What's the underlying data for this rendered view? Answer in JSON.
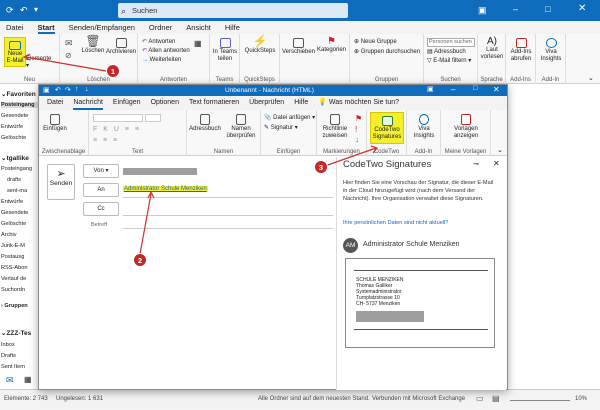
{
  "main": {
    "search_label": "Suchen",
    "tabs": [
      "Datei",
      "Start",
      "Senden/Empfangen",
      "Ordner",
      "Ansicht",
      "Hilfe"
    ],
    "ribbon": {
      "new_email": "Neue E-Mail",
      "new_items": "Elemente",
      "group_new": "Neu",
      "delete": "Löschen",
      "archive": "Archivieren",
      "group_delete": "Löschen",
      "reply": "Antworten",
      "reply_all": "Allen antworten",
      "forward": "Weiterleiten",
      "group_respond": "Antworten",
      "teams_share": "In Teams teilen",
      "group_teams": "Teams",
      "quicksteps": "QuickSteps",
      "group_quicksteps": "QuickSteps",
      "move": "Verschieben",
      "categories": "Kategorien",
      "new_group": "Neue Gruppe",
      "browse_groups": "Gruppen durchsuchen",
      "group_groups": "Gruppen",
      "search_people": "Personen suchen",
      "address_book": "Adressbuch",
      "filter_email": "E-Mail filtern",
      "group_find": "Suchen",
      "read_aloud": "Laut vorlesen",
      "group_speech": "Sprache",
      "get_addins": "Add-Ins abrufen",
      "group_addins": "Add-Ins",
      "viva": "Viva Insights",
      "group_addin2": "Add-In"
    },
    "sidebar": {
      "favorites": "Favoriten",
      "items1": [
        "Posteingang",
        "Gesendete",
        "Entwürfe",
        "Gelöschte"
      ],
      "account": "tgallike",
      "items2": [
        "Posteingang",
        "drafts",
        "sent-ma",
        "Entwürfe",
        "Gesendete",
        "Gelöschte",
        "Archiv",
        "Junk-E-M",
        "Postausg",
        "RSS-Abon",
        "Verlauf de",
        "Suchordn"
      ],
      "groups": "Gruppen",
      "zzz": "ZZZ-Tes",
      "items3": [
        "Inbox",
        "Drafts",
        "Sent Item"
      ]
    },
    "status": {
      "elements": "Elemente: 2 743",
      "unread": "Ungelesen: 1 631",
      "all_current": "Alle Ordner sind auf dem neuesten Stand.",
      "connected": "Verbunden mit Microsoft Exchange",
      "zoom": "10%"
    }
  },
  "compose": {
    "title": "Unbenannt - Nachricht (HTML)",
    "ask": "Was möchten Sie tun?",
    "tabs": [
      "Datei",
      "Nachricht",
      "Einfügen",
      "Optionen",
      "Text formatieren",
      "Überprüfen",
      "Hilfe"
    ],
    "ribbon": {
      "paste": "Einfügen",
      "clipboard": "Zwischenablage",
      "group_text": "Text",
      "address_book": "Adressbuch",
      "check_names": "Namen überprüfen",
      "group_names": "Namen",
      "attach_file": "Datei anfügen",
      "signature": "Signatur",
      "group_insert": "Einfügen",
      "policy": "Richtlinie zuweisen",
      "group_tags": "Markierungen",
      "codetwo": "CodeTwo Signatures",
      "group_codetwo": "CodeTwo",
      "viva": "Viva Insights",
      "group_addin": "Add-In",
      "templates": "Vorlagen anzeigen",
      "group_templates": "Meine Vorlagen"
    },
    "send": "Senden",
    "from": "Von",
    "to": "An",
    "cc": "Cc",
    "subject": "Betreff",
    "recipient": "Administrator Schule Menziken"
  },
  "pane": {
    "title": "CodeTwo Signatures",
    "description": "Hier finden Sie eine Vorschau der Signatur, die dieser E-Mail in der Cloud hinzugefügt wird (nach dem Versand der Nachricht). Ihre Organisation verwaltet diese Signaturen.",
    "link": "Ihre persönlichen Daten sind nicht aktuell?",
    "avatar": "AM",
    "user": "Administrator Schule Menziken",
    "sig_lines": [
      "SCHULE MENZIKEN",
      "Thomas Galliker",
      "Systemadministrator",
      "Turnplatzstrasse 10",
      "CH- 5737 Menziken"
    ]
  },
  "badges": [
    "1",
    "2",
    "3"
  ],
  "colors": {
    "accent": "#0f6cbd",
    "highlight": "#f3ef2c",
    "badge": "#c62828",
    "arrow": "#d32f2f"
  }
}
